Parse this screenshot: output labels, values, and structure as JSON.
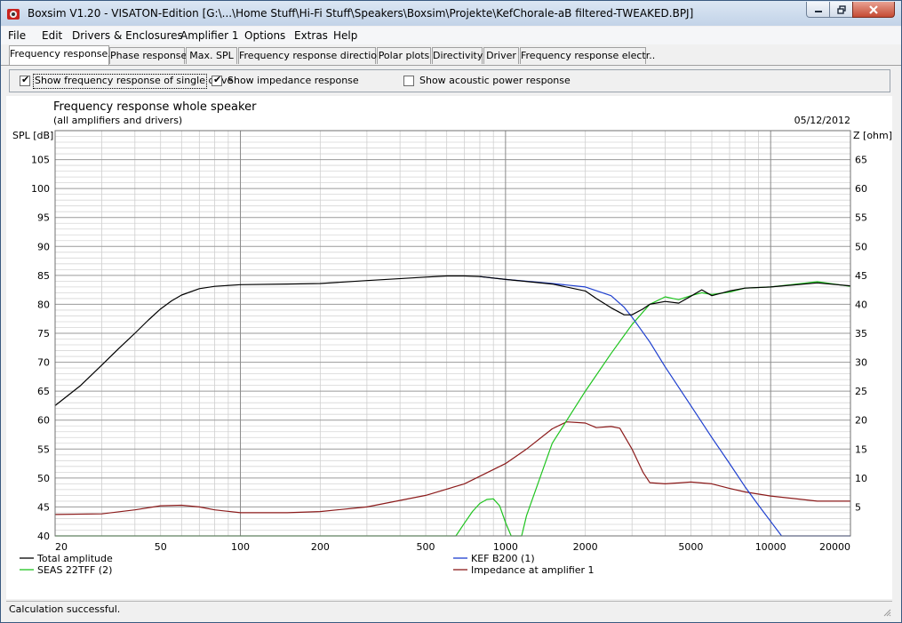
{
  "window": {
    "title": "Boxsim V1.20 - VISATON-Edition [G:\\...\\Home Stuff\\Hi-Fi Stuff\\Speakers\\Boxsim\\Projekte\\KefChorale-aB filtered-TWEAKED.BPJ]"
  },
  "menu": [
    "File",
    "Edit",
    "Drivers & Enclosures",
    "Amplifier 1",
    "Options",
    "Extras",
    "Help"
  ],
  "tabs": [
    {
      "label": "Frequency response.",
      "active": true
    },
    {
      "label": "Phase response"
    },
    {
      "label": "Max. SPL"
    },
    {
      "label": "Frequency response directions"
    },
    {
      "label": "Polar plots"
    },
    {
      "label": "Directivity"
    },
    {
      "label": "Driver"
    },
    {
      "label": "Frequency response electr.."
    }
  ],
  "options": [
    {
      "label": "Show frequency response of single drive",
      "checked": true
    },
    {
      "label": "Show impedance response",
      "checked": true
    },
    {
      "label": "Show acoustic power response",
      "checked": false
    }
  ],
  "status": "Calculation successful.",
  "chart_data": {
    "type": "line",
    "title": "Frequency response whole speaker",
    "subtitle": "(all amplifiers and drivers)",
    "date": "05/12/2012",
    "ylabel": "SPL [dB]",
    "y2label": "Z [ohm]",
    "xscale": "log",
    "xlim": [
      20,
      20000
    ],
    "ylim": [
      40,
      110
    ],
    "y2lim": [
      0,
      70
    ],
    "x_ticks": [
      20,
      50,
      100,
      200,
      500,
      1000,
      2000,
      5000,
      10000,
      20000
    ],
    "y_ticks": [
      40,
      45,
      50,
      55,
      60,
      65,
      70,
      75,
      80,
      85,
      90,
      95,
      100,
      105
    ],
    "y2_ticks": [
      5,
      10,
      15,
      20,
      25,
      30,
      35,
      40,
      45,
      50,
      55,
      60,
      65
    ],
    "grid": true,
    "legend_position": "bottom",
    "series": [
      {
        "name": "Total amplitude",
        "color": "#000000",
        "axis": "left",
        "x": [
          20,
          25,
          30,
          35,
          40,
          45,
          50,
          55,
          60,
          70,
          80,
          100,
          150,
          200,
          300,
          500,
          600,
          700,
          800,
          1000,
          1500,
          2000,
          2200,
          2500,
          2800,
          3000,
          3300,
          3500,
          4000,
          4500,
          5000,
          5500,
          6000,
          7000,
          8000,
          10000,
          15000,
          20000
        ],
        "y": [
          62.5,
          66,
          69.5,
          72.5,
          75,
          77.3,
          79.2,
          80.6,
          81.6,
          82.7,
          83.1,
          83.4,
          83.5,
          83.6,
          84.1,
          84.7,
          84.9,
          84.9,
          84.8,
          84.3,
          83.5,
          82.3,
          81,
          79.4,
          78.2,
          78.2,
          79.2,
          80,
          80.5,
          80.2,
          81.4,
          82.5,
          81.5,
          82.3,
          82.8,
          83,
          83.7,
          83.2
        ]
      },
      {
        "name": "KEF B200 (1)",
        "color": "#1e3fcf",
        "axis": "left",
        "x": [
          800,
          1000,
          1500,
          2000,
          2500,
          2800,
          3000,
          3500,
          4000,
          5000,
          6000,
          7000,
          8000,
          9000,
          10000,
          11000,
          12000,
          20000
        ],
        "y": [
          84.8,
          84.3,
          83.6,
          83,
          81.5,
          79.5,
          77.8,
          73.5,
          69.2,
          62.5,
          57,
          52.5,
          48.5,
          45.3,
          42.5,
          40,
          40,
          40
        ]
      },
      {
        "name": "SEAS 22TFF (2)",
        "color": "#1fc41f",
        "axis": "left",
        "x": [
          20,
          650,
          700,
          750,
          800,
          850,
          900,
          950,
          1000,
          1050,
          1100,
          1150,
          1200,
          1300,
          1500,
          2000,
          2500,
          3000,
          3500,
          4000,
          4500,
          5000,
          5500,
          6000,
          7000,
          8000,
          10000,
          15000,
          20000
        ],
        "y": [
          40,
          40,
          42.2,
          44.2,
          45.6,
          46.3,
          46.4,
          45.2,
          42.3,
          40,
          40,
          40,
          43.5,
          48,
          56,
          65,
          71.5,
          76.5,
          80,
          81.3,
          80.8,
          81.5,
          82,
          81.7,
          82.1,
          82.8,
          83,
          83.9,
          83.1
        ]
      },
      {
        "name": "Impedance at amplifier 1",
        "color": "#8b1a1a",
        "axis": "right",
        "x": [
          20,
          30,
          40,
          50,
          60,
          70,
          80,
          100,
          150,
          200,
          300,
          500,
          700,
          1000,
          1200,
          1500,
          1700,
          2000,
          2200,
          2500,
          2700,
          3000,
          3300,
          3500,
          4000,
          5000,
          6000,
          7000,
          8000,
          10000,
          15000,
          20000
        ],
        "y": [
          3.7,
          3.8,
          4.5,
          5.2,
          5.3,
          5,
          4.5,
          4,
          4,
          4.2,
          5,
          7,
          9,
          12.5,
          15,
          18.5,
          19.7,
          19.5,
          18.7,
          18.9,
          18.6,
          15,
          11,
          9.2,
          9,
          9.3,
          9,
          8.2,
          7.6,
          6.9,
          6,
          6
        ]
      }
    ]
  }
}
